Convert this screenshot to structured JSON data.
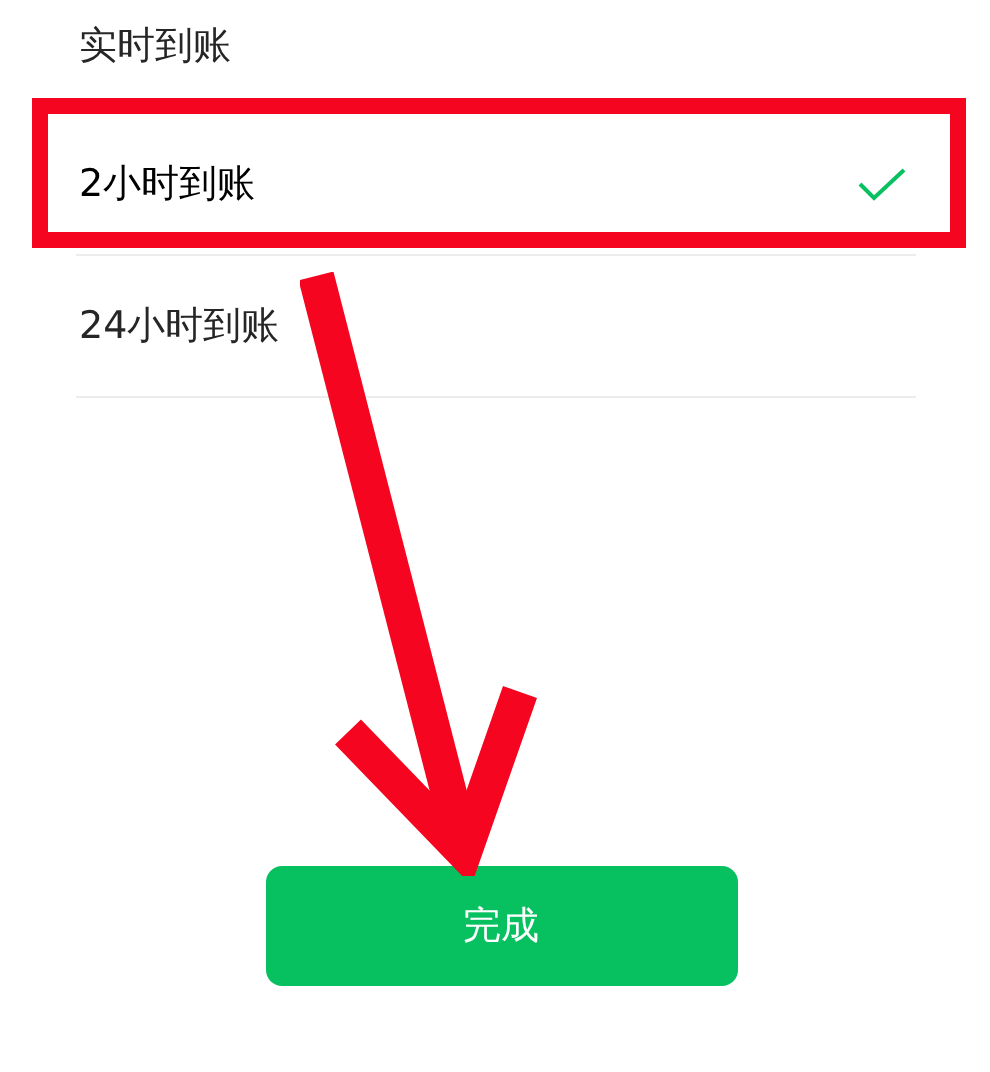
{
  "options": [
    {
      "label": "实时到账",
      "selected": false
    },
    {
      "label": "2小时到账",
      "selected": true
    },
    {
      "label": "24小时到账",
      "selected": false
    }
  ],
  "done_button": "完成"
}
